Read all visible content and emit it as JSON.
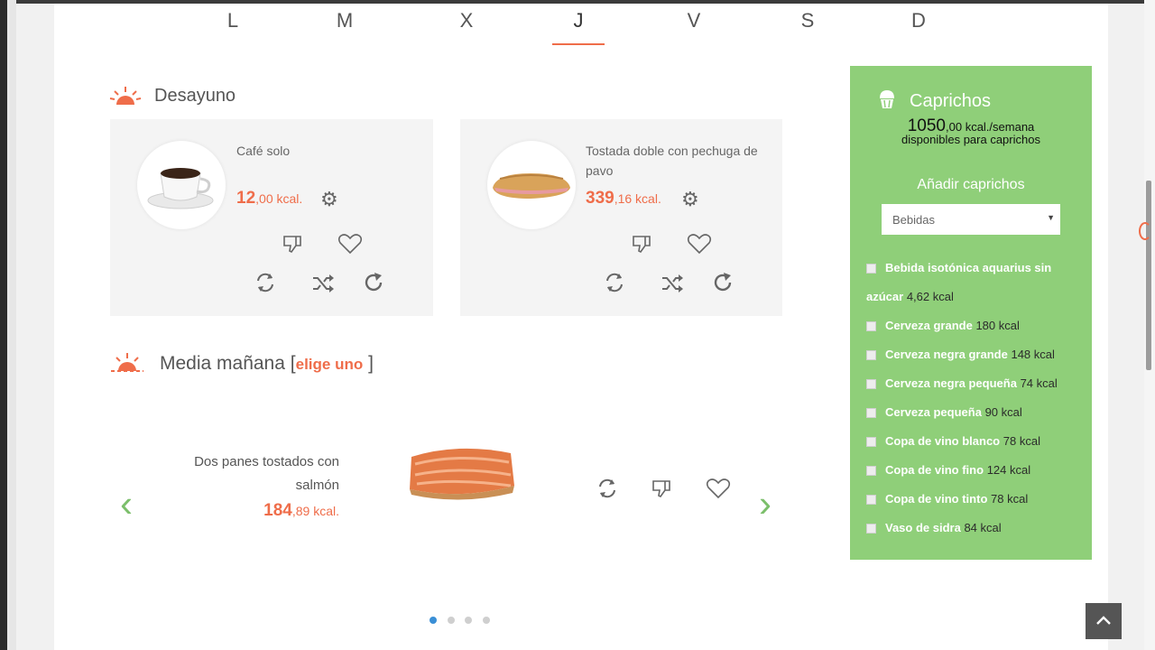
{
  "days": [
    "L",
    "M",
    "X",
    "J",
    "V",
    "S",
    "D"
  ],
  "selected_day": "J",
  "desayuno": {
    "title": "Desayuno",
    "items": [
      {
        "name": "Café solo",
        "kcal_int": "12",
        "kcal_dec": ",00 kcal."
      },
      {
        "name": "Tostada doble con pechuga de pavo",
        "kcal_int": "339",
        "kcal_dec": ",16 kcal."
      }
    ]
  },
  "media_manana": {
    "title": "Media mañana",
    "bracket_open": "[",
    "choose": "elige uno",
    "bracket_close": "]",
    "item": {
      "name_line1": "Dos panes tostados con",
      "name_line2": "salmón",
      "kcal_int": "184",
      "kcal_dec": ",89 kcal."
    }
  },
  "caprichos": {
    "title": "Caprichos",
    "kcal_value": "1050",
    "kcal_dec": ",00",
    "kcal_unit": " kcal./semana",
    "subtitle": "disponibles para caprichos",
    "add_label": "Añadir caprichos",
    "select_value": "Bebidas",
    "items": [
      {
        "name": "Bebida isotónica aquarius sin",
        "name2": "azúcar",
        "kcal": "4,62",
        "unit": "kcal"
      },
      {
        "name": "Cerveza grande",
        "kcal": "180",
        "unit": "kcal"
      },
      {
        "name": "Cerveza negra grande",
        "kcal": "148",
        "unit": "kcal"
      },
      {
        "name": "Cerveza negra pequeña",
        "kcal": "74",
        "unit": "kcal"
      },
      {
        "name": "Cerveza pequeña",
        "kcal": "90",
        "unit": "kcal"
      },
      {
        "name": "Copa de vino blanco",
        "kcal": "78",
        "unit": "kcal"
      },
      {
        "name": "Copa de vino fino",
        "kcal": "124",
        "unit": "kcal"
      },
      {
        "name": "Copa de vino tinto",
        "kcal": "78",
        "unit": "kcal"
      },
      {
        "name": "Vaso de sidra",
        "kcal": "84",
        "unit": "kcal"
      }
    ]
  },
  "carousel": {
    "dots": 4,
    "active": 0
  },
  "colors": {
    "accent": "#ef6d4a",
    "green_panel": "#8fcf79",
    "arrow": "#7cbf6b",
    "dot_active": "#3a8fd6"
  }
}
